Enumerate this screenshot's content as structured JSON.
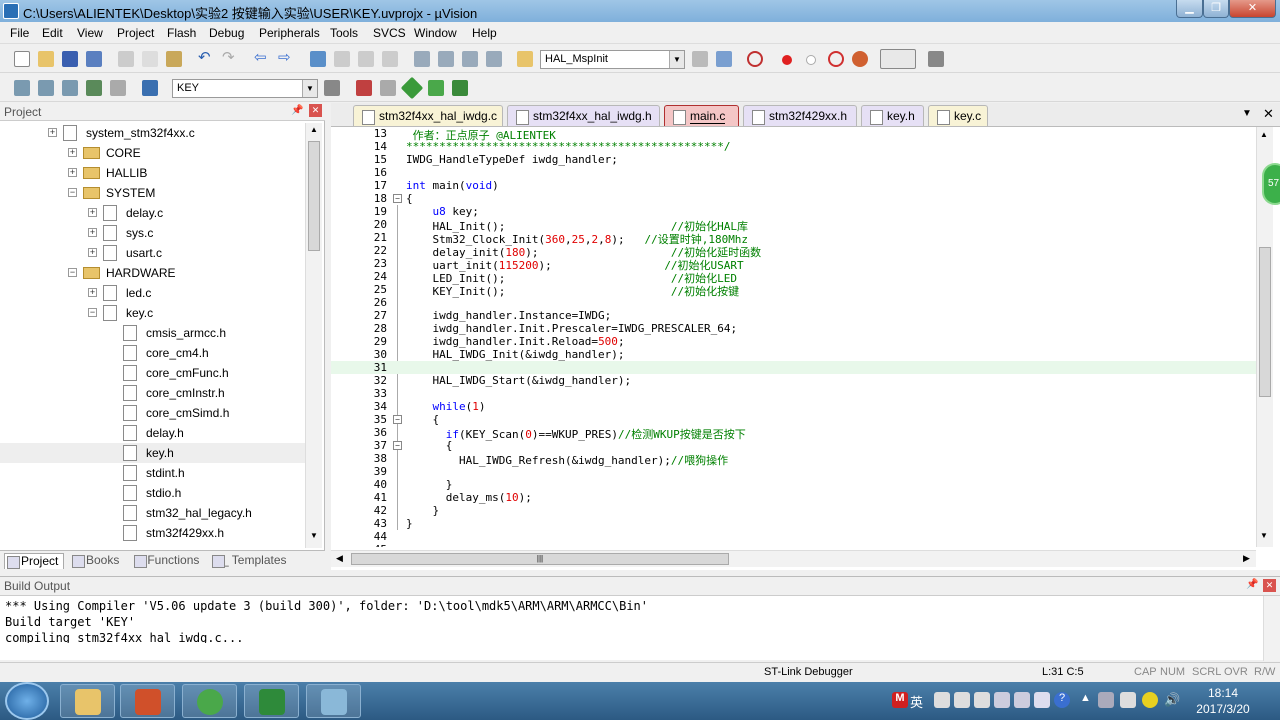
{
  "window": {
    "title": "C:\\Users\\ALIENTEK\\Desktop\\实验2 按键输入实验\\USER\\KEY.uvprojx - µVision"
  },
  "menu": [
    "File",
    "Edit",
    "View",
    "Project",
    "Flash",
    "Debug",
    "Peripherals",
    "Tools",
    "SVCS",
    "Window",
    "Help"
  ],
  "toolbar": {
    "function_combo": "HAL_MspInit",
    "target_combo": "KEY"
  },
  "project": {
    "header": "Project",
    "tree": [
      {
        "label": "system_stm32f4xx.c",
        "type": "file",
        "expander": "+"
      },
      {
        "label": "CORE",
        "type": "folder",
        "expander": "+"
      },
      {
        "label": "HALLIB",
        "type": "folder",
        "expander": "+"
      },
      {
        "label": "SYSTEM",
        "type": "folder",
        "expander": "-"
      },
      {
        "label": "delay.c",
        "type": "file",
        "expander": "+"
      },
      {
        "label": "sys.c",
        "type": "file",
        "expander": "+"
      },
      {
        "label": "usart.c",
        "type": "file",
        "expander": "+"
      },
      {
        "label": "HARDWARE",
        "type": "folder",
        "expander": "-"
      },
      {
        "label": "led.c",
        "type": "file",
        "expander": "+"
      },
      {
        "label": "key.c",
        "type": "file",
        "expander": "-"
      },
      {
        "label": "cmsis_armcc.h",
        "type": "file",
        "expander": ""
      },
      {
        "label": "core_cm4.h",
        "type": "file",
        "expander": ""
      },
      {
        "label": "core_cmFunc.h",
        "type": "file",
        "expander": ""
      },
      {
        "label": "core_cmInstr.h",
        "type": "file",
        "expander": ""
      },
      {
        "label": "core_cmSimd.h",
        "type": "file",
        "expander": ""
      },
      {
        "label": "delay.h",
        "type": "file",
        "expander": ""
      },
      {
        "label": "key.h",
        "type": "file",
        "expander": "",
        "selected": true
      },
      {
        "label": "stdint.h",
        "type": "file",
        "expander": ""
      },
      {
        "label": "stdio.h",
        "type": "file",
        "expander": ""
      },
      {
        "label": "stm32_hal_legacy.h",
        "type": "file",
        "expander": ""
      },
      {
        "label": "stm32f429xx.h",
        "type": "file",
        "expander": ""
      }
    ],
    "tabs": [
      "Project",
      "Books",
      "{} Functions",
      "{}_ Templates"
    ]
  },
  "editor": {
    "tabs": [
      {
        "label": "stm32f4xx_hal_iwdg.c",
        "kind": "c"
      },
      {
        "label": "stm32f4xx_hal_iwdg.h",
        "kind": "h"
      },
      {
        "label": "main.c",
        "kind": "c",
        "active": true
      },
      {
        "label": "stm32f429xx.h",
        "kind": "h"
      },
      {
        "label": "key.h",
        "kind": "h"
      },
      {
        "label": "key.c",
        "kind": "c"
      }
    ],
    "lines": [
      {
        "n": "13",
        "html": "<span class='cmt'> 作者：正点原子 @ALIENTEK</span>"
      },
      {
        "n": "14",
        "html": "<span class='cmt'>************************************************/</span>"
      },
      {
        "n": "15",
        "html": "IWDG_HandleTypeDef iwdg_handler;"
      },
      {
        "n": "16",
        "html": ""
      },
      {
        "n": "17",
        "html": "<span class='kw'>int</span> main(<span class='kw'>void</span>)"
      },
      {
        "n": "18",
        "html": "{"
      },
      {
        "n": "19",
        "html": "    <span class='kw'>u8</span> key;"
      },
      {
        "n": "20",
        "html": "    HAL_Init();                         <span class='cmt'>//初始化HAL库</span>"
      },
      {
        "n": "21",
        "html": "    Stm32_Clock_Init(<span class='num'>360</span>,<span class='num'>25</span>,<span class='num'>2</span>,<span class='num'>8</span>);   <span class='cmt'>//设置时钟,180Mhz</span>"
      },
      {
        "n": "22",
        "html": "    delay_init(<span class='num'>180</span>);                    <span class='cmt'>//初始化延时函数</span>"
      },
      {
        "n": "23",
        "html": "    uart_init(<span class='num'>115200</span>);                 <span class='cmt'>//初始化USART</span>"
      },
      {
        "n": "24",
        "html": "    LED_Init();                         <span class='cmt'>//初始化LED</span>"
      },
      {
        "n": "25",
        "html": "    KEY_Init();                         <span class='cmt'>//初始化按键</span>"
      },
      {
        "n": "26",
        "html": ""
      },
      {
        "n": "27",
        "html": "    iwdg_handler.Instance=IWDG;"
      },
      {
        "n": "28",
        "html": "    iwdg_handler.Init.Prescaler=IWDG_PRESCALER_64;"
      },
      {
        "n": "29",
        "html": "    iwdg_handler.Init.Reload=<span class='num'>500</span>;"
      },
      {
        "n": "30",
        "html": "    HAL_IWDG_Init(&amp;iwdg_handler);"
      },
      {
        "n": "31",
        "html": "",
        "current": true
      },
      {
        "n": "32",
        "html": "    HAL_IWDG_Start(&amp;iwdg_handler);"
      },
      {
        "n": "33",
        "html": ""
      },
      {
        "n": "34",
        "html": "    <span class='kw'>while</span>(<span class='num'>1</span>)"
      },
      {
        "n": "35",
        "html": "    {"
      },
      {
        "n": "36",
        "html": "      <span class='kw'>if</span>(KEY_Scan(<span class='num'>0</span>)==WKUP_PRES)<span class='cmt'>//检测WKUP按键是否按下</span>"
      },
      {
        "n": "37",
        "html": "      {"
      },
      {
        "n": "38",
        "html": "        HAL_IWDG_Refresh(&amp;iwdg_handler);<span class='cmt'>//喂狗操作</span>"
      },
      {
        "n": "39",
        "html": ""
      },
      {
        "n": "40",
        "html": "      }"
      },
      {
        "n": "41",
        "html": "      delay_ms(<span class='num'>10</span>);"
      },
      {
        "n": "42",
        "html": "    }"
      },
      {
        "n": "43",
        "html": "}"
      },
      {
        "n": "44",
        "html": ""
      },
      {
        "n": "45",
        "html": ""
      }
    ],
    "side_badge": "57"
  },
  "output": {
    "header": "Build Output",
    "lines": [
      "*** Using Compiler 'V5.06 update 3 (build 300)', folder: 'D:\\tool\\mdk5\\ARM\\ARM\\ARMCC\\Bin'",
      "Build target 'KEY'",
      "compiling stm32f4xx_hal_iwdg.c..."
    ]
  },
  "status": {
    "debugger": "ST-Link Debugger",
    "position": "L:31 C:5",
    "caps": "CAP",
    "num": "NUM",
    "scrl": "SCRL",
    "ovr": "OVR",
    "rw": "R/W"
  },
  "taskbar": {
    "time": "18:14",
    "date": "2017/3/20",
    "ime": "英"
  }
}
